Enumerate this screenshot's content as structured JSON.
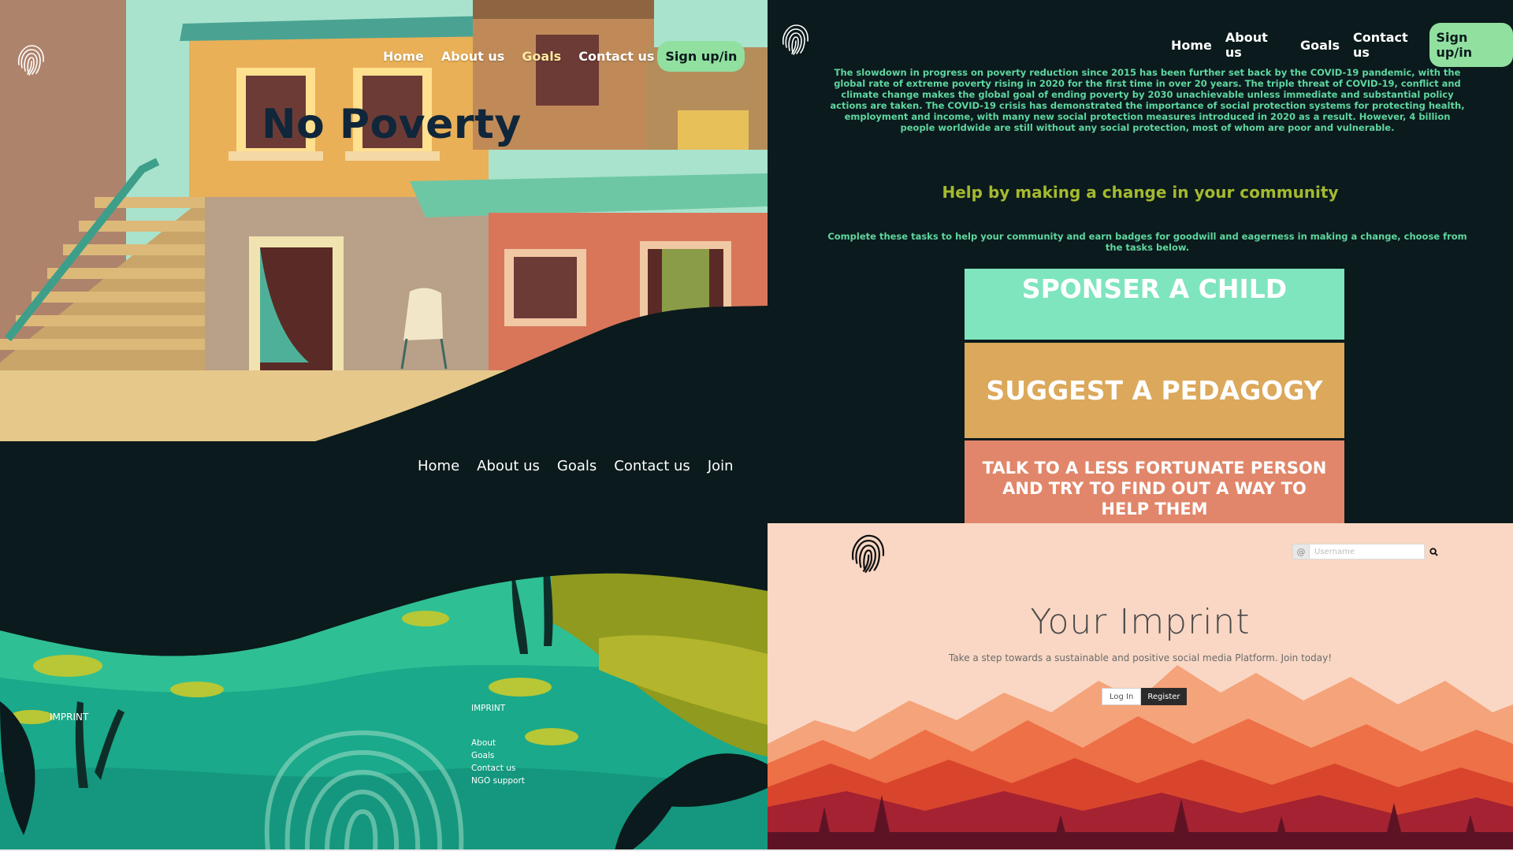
{
  "panel_hero": {
    "nav": [
      "Home",
      "About us",
      "Goals",
      "Contact us"
    ],
    "signup": "Sign up/in",
    "title": "No Poverty"
  },
  "panel_tasks": {
    "nav": [
      "Home",
      "About us",
      "Goals",
      "Contact us"
    ],
    "signup": "Sign up/in",
    "intro": "The slowdown in progress on poverty reduction since 2015 has been further set back by the COVID-19 pandemic, with the global rate of extreme poverty rising in 2020 for the first time in over 20 years. The triple threat of COVID-19, conflict and climate change makes the global goal of ending poverty by 2030 unachievable unless immediate and substantial policy actions are taken. The COVID-19 crisis has demonstrated the importance of social protection systems for protecting health, employment and income, with many new social protection measures introduced in 2020 as a result. However, 4 billion people worldwide are still without any social protection, most of whom are poor and vulnerable.",
    "help_heading": "Help by making a change in your community",
    "tasks_intro": "Complete these tasks to help your community and earn badges for goodwill and eagerness in making a change, choose from the tasks below.",
    "tasks": [
      "SPONSER A CHILD",
      "SUGGEST A PEDAGOGY",
      "TALK TO A LESS FORTUNATE PERSON AND TRY TO FIND OUT A WAY  TO HELP THEM"
    ]
  },
  "panel_footer": {
    "nav": [
      "Home",
      "About us",
      "Goals",
      "Contact us",
      "Join"
    ],
    "imprint_left": "IMPRINT",
    "imprint_heading": "IMPRINT",
    "links": [
      "About",
      "Goals",
      "Contact us",
      "NGO support"
    ]
  },
  "panel_login": {
    "search_placeholder": "Username",
    "title": "Your Imprint",
    "tagline": "Take a step towards a sustainable and positive social media Platform. Join today!",
    "login": "Log In",
    "register": "Register"
  },
  "colors": {
    "dark_bg": "#0b1a1c",
    "signup_green": "#91e0a0",
    "body_green": "#5fd6a0",
    "heading_olive": "#a5b930",
    "task_mint": "#7ee5bf",
    "task_gold": "#dca85b",
    "task_coral": "#e1866a",
    "login_peach": "#f9d7c4"
  },
  "icons": [
    "fingerprint-icon",
    "search-icon",
    "user-icon"
  ]
}
